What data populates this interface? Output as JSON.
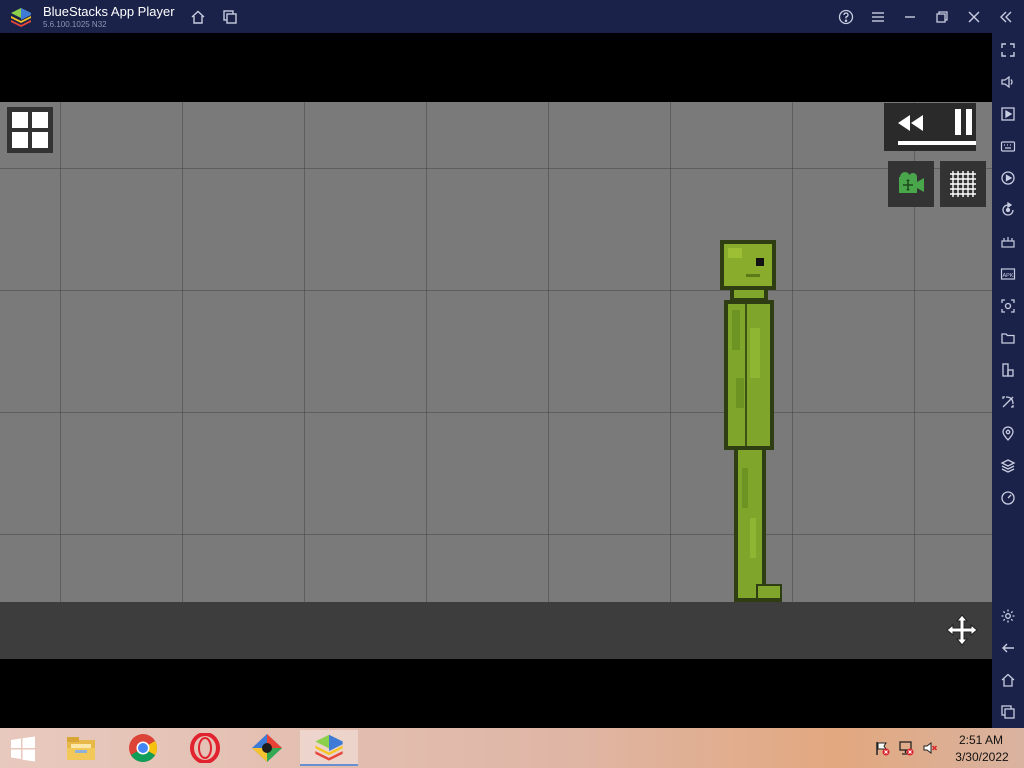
{
  "titlebar": {
    "title": "BlueStacks App Player",
    "version": "5.6.100.1025  N32",
    "icons": [
      "home-icon",
      "multi-instance-icon",
      "help-icon",
      "menu-icon",
      "minimize-icon",
      "restore-icon",
      "close-icon",
      "collapse-sidebar-icon"
    ]
  },
  "sidebar": {
    "icons": [
      "fullscreen-icon",
      "volume-icon",
      "media-manager-icon",
      "keyboard-controls-icon",
      "macro-record-icon",
      "sync-icon",
      "game-controls-icon",
      "install-apk-icon",
      "screenshot-icon",
      "folder-icon",
      "multi-instance-manager-icon",
      "eco-mode-icon",
      "location-icon",
      "layers-icon",
      "performance-icon",
      "settings-icon",
      "back-icon",
      "android-home-icon",
      "recent-apps-icon"
    ]
  },
  "game": {
    "character": "melon-figure",
    "playing": true,
    "tools": [
      "camera-move-icon",
      "grid-toggle-icon"
    ]
  },
  "taskbar": {
    "apps": [
      "file-explorer-icon",
      "chrome-icon",
      "opera-icon",
      "game-app-icon",
      "bluestacks-icon"
    ],
    "active_app": "bluestacks-icon",
    "time": "2:51 AM",
    "date": "3/30/2022"
  },
  "colors": {
    "titlebar_bg": "#1b2249",
    "scene_bg": "#7a7a7a",
    "melon_green": "#7fa62a"
  }
}
